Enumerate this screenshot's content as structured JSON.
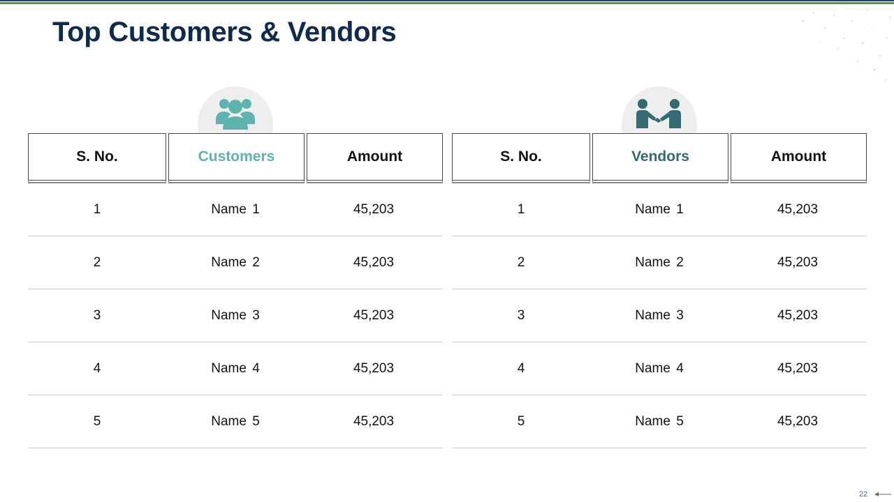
{
  "colors": {
    "title": "#0f2a4f",
    "accent_teal": "#5db3ad",
    "accent_dark_teal": "#336b73",
    "top_bar_blue": "#1f3f6e",
    "top_bar_green": "#4a9a3c",
    "page_number": "#3a6a9a"
  },
  "page": {
    "title": "Top Customers & Vendors",
    "number": "22"
  },
  "customers_table": {
    "icon": "users-group-icon",
    "headers": [
      "S. No.",
      "Customers",
      "Amount"
    ],
    "rows": [
      [
        "1",
        "Name 1",
        "45,203"
      ],
      [
        "2",
        "Name 2",
        "45,203"
      ],
      [
        "3",
        "Name 3",
        "45,203"
      ],
      [
        "4",
        "Name 4",
        "45,203"
      ],
      [
        "5",
        "Name 5",
        "45,203"
      ]
    ]
  },
  "vendors_table": {
    "icon": "handshake-icon",
    "headers": [
      "S. No.",
      "Vendors",
      "Amount"
    ],
    "rows": [
      [
        "1",
        "Name 1",
        "45,203"
      ],
      [
        "2",
        "Name 2",
        "45,203"
      ],
      [
        "3",
        "Name 3",
        "45,203"
      ],
      [
        "4",
        "Name 4",
        "45,203"
      ],
      [
        "5",
        "Name 5",
        "45,203"
      ]
    ]
  }
}
